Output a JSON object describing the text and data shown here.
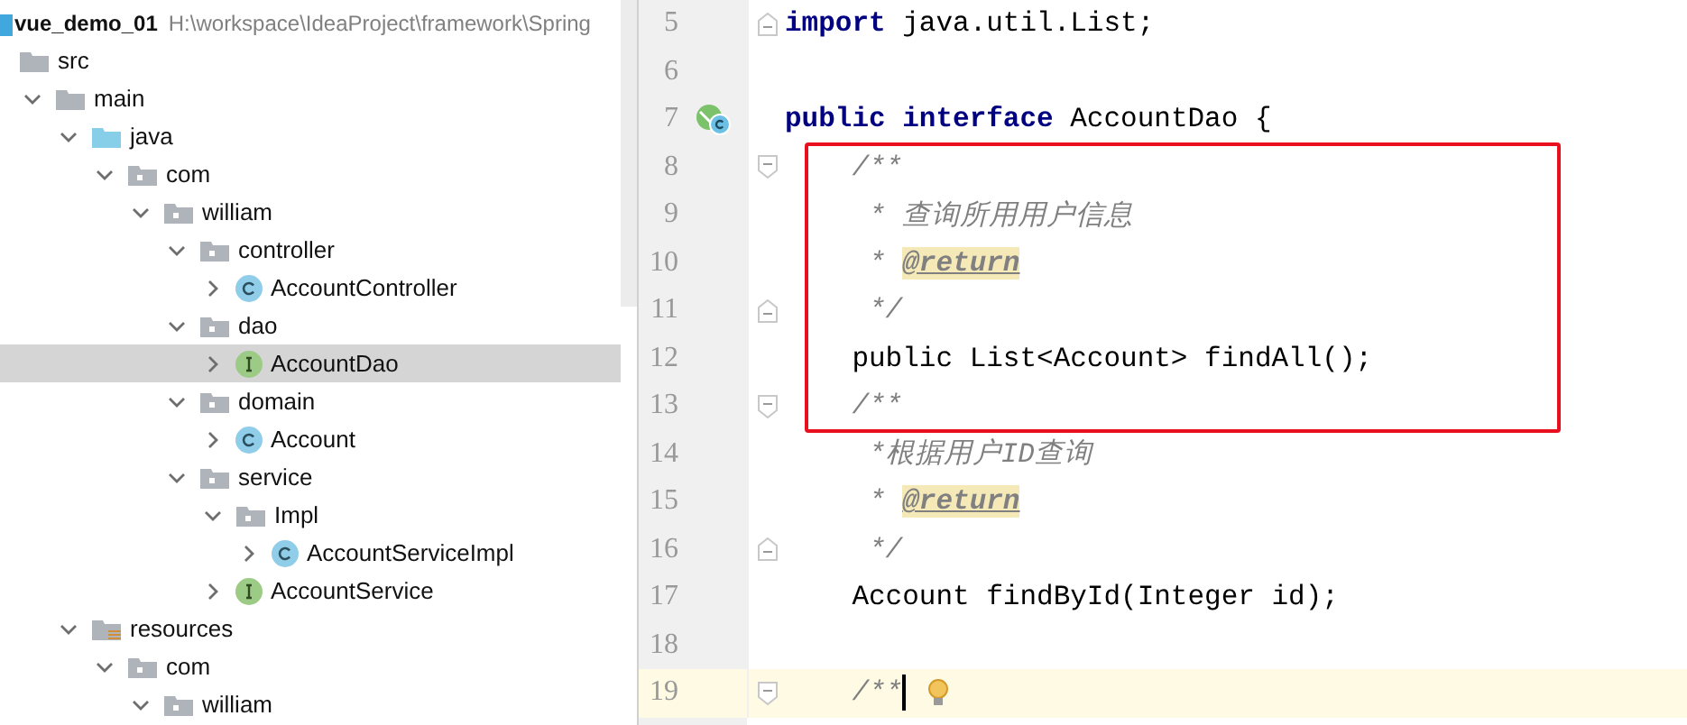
{
  "project_tree": {
    "items": [
      {
        "kind": "module",
        "label": "vue_demo_01",
        "path": "H:\\workspace\\IdeaProject\\framework\\Spring",
        "selected": false,
        "children": [
          {
            "kind": "folder",
            "label": "src",
            "selected": false
          },
          {
            "kind": "folder",
            "label": "main",
            "expanded": true,
            "selected": false,
            "children": [
              {
                "kind": "source-folder",
                "label": "java",
                "expanded": true,
                "selected": false,
                "children": [
                  {
                    "kind": "package",
                    "label": "com",
                    "expanded": true,
                    "selected": false,
                    "children": [
                      {
                        "kind": "package",
                        "label": "william",
                        "expanded": true,
                        "selected": false,
                        "children": [
                          {
                            "kind": "package",
                            "label": "controller",
                            "expanded": true,
                            "selected": false,
                            "children": [
                              {
                                "kind": "class",
                                "label": "AccountController",
                                "expanded": false,
                                "selected": false
                              }
                            ]
                          },
                          {
                            "kind": "package",
                            "label": "dao",
                            "expanded": true,
                            "selected": false,
                            "children": [
                              {
                                "kind": "interface",
                                "label": "AccountDao",
                                "expanded": false,
                                "selected": true
                              }
                            ]
                          },
                          {
                            "kind": "package",
                            "label": "domain",
                            "expanded": true,
                            "selected": false,
                            "children": [
                              {
                                "kind": "class",
                                "label": "Account",
                                "expanded": false,
                                "selected": false
                              }
                            ]
                          },
                          {
                            "kind": "package",
                            "label": "service",
                            "expanded": true,
                            "selected": false,
                            "children": [
                              {
                                "kind": "package",
                                "label": "Impl",
                                "expanded": true,
                                "selected": false,
                                "children": [
                                  {
                                    "kind": "class",
                                    "label": "AccountServiceImpl",
                                    "expanded": false,
                                    "selected": false
                                  }
                                ]
                              },
                              {
                                "kind": "interface",
                                "label": "AccountService",
                                "expanded": false,
                                "selected": false
                              }
                            ]
                          }
                        ]
                      }
                    ]
                  }
                ]
              },
              {
                "kind": "resource-folder",
                "label": "resources",
                "expanded": true,
                "selected": false,
                "children": [
                  {
                    "kind": "package",
                    "label": "com",
                    "expanded": true,
                    "selected": false,
                    "children": [
                      {
                        "kind": "package",
                        "label": "william",
                        "expanded": true,
                        "selected": false
                      }
                    ]
                  }
                ]
              }
            ]
          }
        ]
      }
    ]
  },
  "editor": {
    "lines": [
      {
        "number": "5",
        "fold_end": true,
        "boxed": false,
        "current": false,
        "tokens": [
          {
            "kind": "keyword",
            "text": "import"
          },
          {
            "kind": "plain",
            "text": " java.util.List;"
          }
        ]
      },
      {
        "number": "6",
        "boxed": false,
        "current": false
      },
      {
        "number": "7",
        "implemented_marker": true,
        "boxed": false,
        "current": false,
        "tokens": [
          {
            "kind": "keyword",
            "text": "public interface"
          },
          {
            "kind": "plain",
            "text": " AccountDao {"
          }
        ]
      },
      {
        "number": "8",
        "fold_start": true,
        "boxed": true,
        "current": false,
        "tokens": [
          {
            "kind": "comment",
            "text": "    /**"
          }
        ]
      },
      {
        "number": "9",
        "boxed": true,
        "current": false,
        "tokens": [
          {
            "kind": "comment",
            "text": "     * 查询所用用户信息"
          }
        ]
      },
      {
        "number": "10",
        "boxed": true,
        "current": false,
        "tokens": [
          {
            "kind": "comment",
            "text": "     * "
          },
          {
            "kind": "doc-tag",
            "text": "@return"
          }
        ]
      },
      {
        "number": "11",
        "fold_end": true,
        "boxed": true,
        "current": false,
        "tokens": [
          {
            "kind": "comment",
            "text": "     */"
          }
        ]
      },
      {
        "number": "12",
        "boxed": true,
        "current": false,
        "tokens": [
          {
            "kind": "plain",
            "text": "    public List<Account> findAll();"
          }
        ]
      },
      {
        "number": "13",
        "fold_start": true,
        "boxed": true,
        "current": false,
        "tokens": [
          {
            "kind": "comment",
            "text": "    /**"
          }
        ]
      },
      {
        "number": "14",
        "boxed": false,
        "current": false,
        "tokens": [
          {
            "kind": "comment",
            "text": "     *根据用户ID查询"
          }
        ]
      },
      {
        "number": "15",
        "boxed": false,
        "current": false,
        "tokens": [
          {
            "kind": "comment",
            "text": "     * "
          },
          {
            "kind": "doc-tag",
            "text": "@return"
          }
        ]
      },
      {
        "number": "16",
        "fold_end": true,
        "boxed": false,
        "current": false,
        "tokens": [
          {
            "kind": "comment",
            "text": "     */"
          }
        ]
      },
      {
        "number": "17",
        "boxed": false,
        "current": false,
        "tokens": [
          {
            "kind": "plain",
            "text": "    Account findById(Integer id);"
          }
        ]
      },
      {
        "number": "18",
        "boxed": false,
        "current": false
      },
      {
        "number": "19",
        "fold_start": true,
        "boxed": false,
        "current": true,
        "caret": true,
        "intention_bulb": true,
        "tokens": [
          {
            "kind": "comment",
            "text": "    /**"
          }
        ]
      }
    ]
  }
}
